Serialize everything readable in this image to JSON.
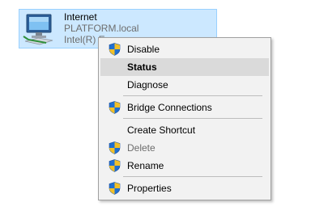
{
  "adapter": {
    "name": "Internet",
    "domain": "PLATFORM.local",
    "device": "Intel(R) E"
  },
  "context_menu": {
    "items": [
      {
        "label": "Disable",
        "shield": true,
        "bold": false,
        "disabled": false
      },
      {
        "label": "Status",
        "shield": false,
        "bold": true,
        "disabled": false,
        "highlighted": true
      },
      {
        "label": "Diagnose",
        "shield": false,
        "bold": false,
        "disabled": false
      },
      {
        "label": "Bridge Connections",
        "shield": true,
        "bold": false,
        "disabled": false
      },
      {
        "label": "Create Shortcut",
        "shield": false,
        "bold": false,
        "disabled": false
      },
      {
        "label": "Delete",
        "shield": true,
        "bold": false,
        "disabled": true
      },
      {
        "label": "Rename",
        "shield": true,
        "bold": false,
        "disabled": false
      },
      {
        "label": "Properties",
        "shield": true,
        "bold": false,
        "disabled": false
      }
    ]
  },
  "colors": {
    "selection_fill": "#cce8ff",
    "selection_border": "#99d1ff",
    "menu_background": "#f2f2f2",
    "menu_hover": "#dadada",
    "disabled_text": "#6d6d6d"
  },
  "icons": {
    "adapter": "network-adapter-icon",
    "uac": "uac-shield-icon"
  }
}
